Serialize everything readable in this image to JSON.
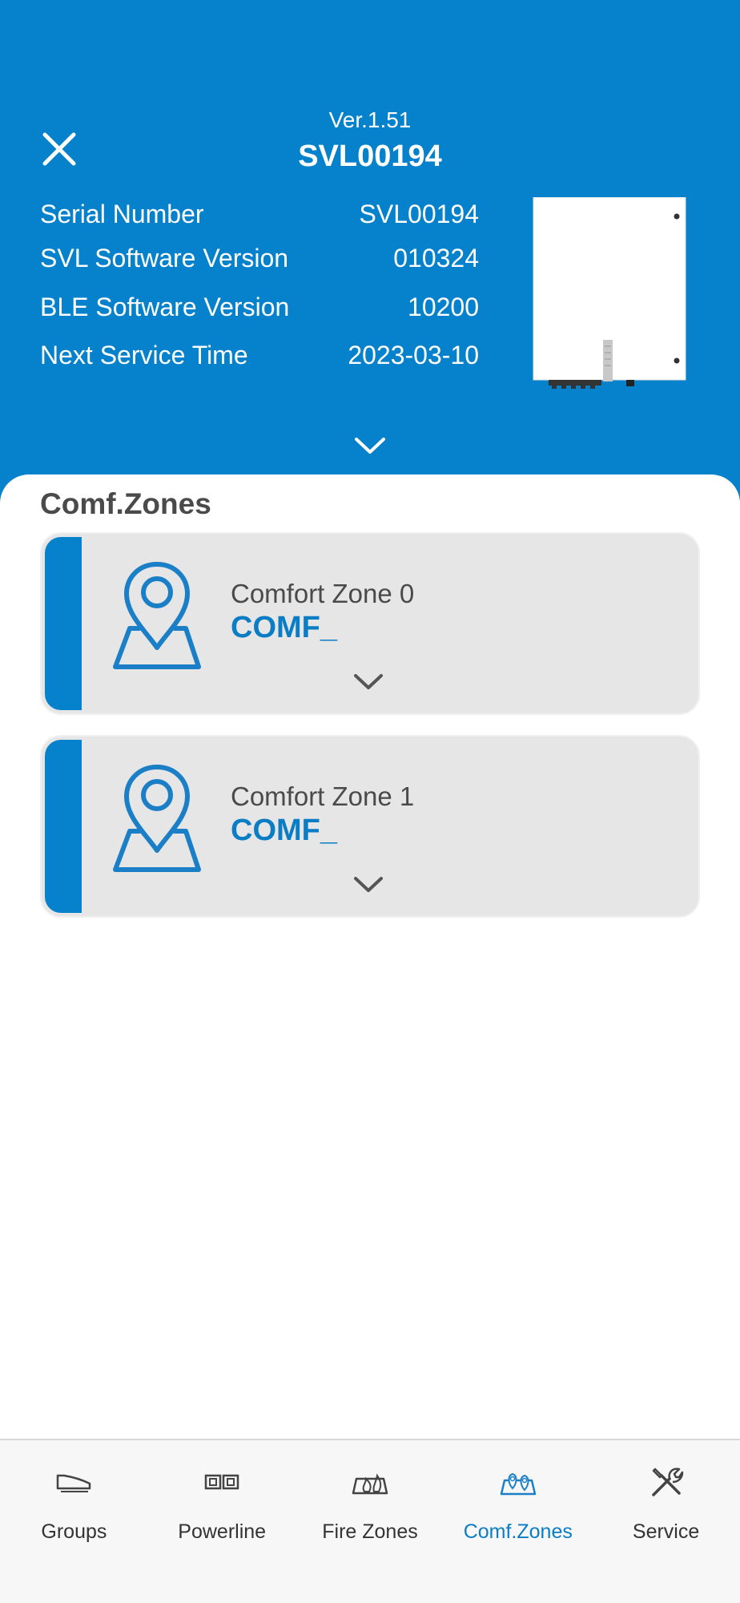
{
  "header": {
    "version": "Ver.1.51",
    "device_name": "SVL00194",
    "info": [
      {
        "label": "Serial Number",
        "value": "SVL00194"
      },
      {
        "label": "SVL Software Version",
        "value": "010324"
      },
      {
        "label": "BLE Software Version",
        "value": "10200"
      },
      {
        "label": "Next Service Time",
        "value": "2023-03-10"
      }
    ],
    "background_color": "#0681cb"
  },
  "section": {
    "title": "Comf.Zones"
  },
  "zones": [
    {
      "name": "Comfort Zone 0",
      "code": "COMF_"
    },
    {
      "name": "Comfort Zone 1",
      "code": "COMF_"
    }
  ],
  "tabs": [
    {
      "label": "Groups",
      "icon": "groups-icon",
      "active": false
    },
    {
      "label": "Powerline",
      "icon": "powerline-icon",
      "active": false
    },
    {
      "label": "Fire Zones",
      "icon": "fire-zones-icon",
      "active": false
    },
    {
      "label": "Comf.Zones",
      "icon": "comf-zones-icon",
      "active": true
    },
    {
      "label": "Service",
      "icon": "service-icon",
      "active": false
    }
  ],
  "colors": {
    "accent": "#0681cb",
    "active_tab": "#0a7dc4",
    "card_background": "#e6e6e6"
  }
}
